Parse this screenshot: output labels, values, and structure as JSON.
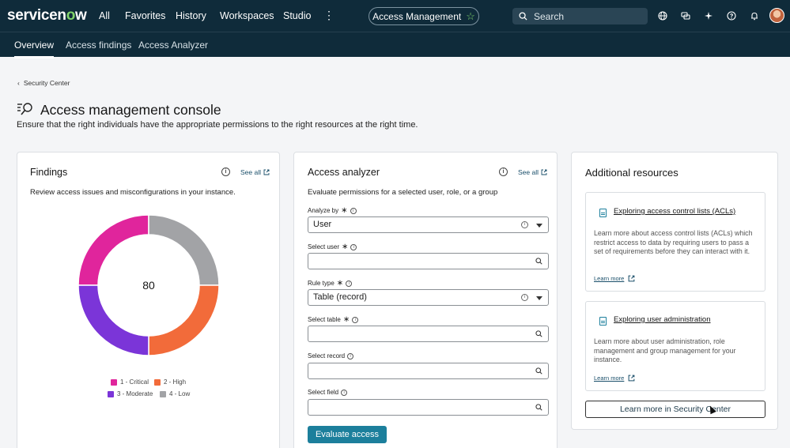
{
  "brand": {
    "logo_main": "servicen",
    "logo_accent": "o",
    "logo_tail": "w"
  },
  "topnav": {
    "items": [
      "All",
      "Favorites",
      "History",
      "Workspaces",
      "Studio"
    ],
    "app_pill": "Access Management",
    "search_placeholder": "Search",
    "icons": [
      "globe-icon",
      "chat-icon",
      "sparkle-icon",
      "help-icon",
      "bell-icon",
      "avatar"
    ]
  },
  "subnav": {
    "tabs": [
      "Overview",
      "Access findings",
      "Access Analyzer"
    ],
    "active": "Overview"
  },
  "breadcrumb": {
    "label": "Security Center"
  },
  "page": {
    "title": "Access management console",
    "subtitle": "Ensure that the right individuals have the appropriate permissions to the right resources at the right time."
  },
  "findings": {
    "title": "Findings",
    "see_all": "See all",
    "description": "Review access issues and misconfigurations in your instance.",
    "total": "80",
    "legend": [
      {
        "label": "1 - Critical",
        "color": "#e0259c"
      },
      {
        "label": "2 - High",
        "color": "#f26b3a"
      },
      {
        "label": "3 - Moderate",
        "color": "#7b35d8"
      },
      {
        "label": "4 - Low",
        "color": "#a2a3a6"
      }
    ]
  },
  "chart_data": {
    "type": "pie",
    "donut": true,
    "center_label": "80",
    "series": [
      {
        "name": "1 - Critical",
        "value": 20,
        "color": "#e0259c"
      },
      {
        "name": "4 - Low",
        "value": 20,
        "color": "#a2a3a6"
      },
      {
        "name": "2 - High",
        "value": 20,
        "color": "#f26b3a"
      },
      {
        "name": "3 - Moderate",
        "value": 20,
        "color": "#7b35d8"
      }
    ],
    "legend_position": "bottom"
  },
  "analyzer": {
    "title": "Access analyzer",
    "see_all": "See all",
    "description": "Evaluate permissions for a selected user, role, or a group",
    "fields": {
      "analyze_by": {
        "label": "Analyze by",
        "value": "User"
      },
      "select_user": {
        "label": "Select user",
        "value": ""
      },
      "rule_type": {
        "label": "Rule type",
        "value": "Table (record)"
      },
      "select_table": {
        "label": "Select table",
        "value": ""
      },
      "select_record": {
        "label": "Select record",
        "value": ""
      },
      "select_field": {
        "label": "Select field",
        "value": ""
      }
    },
    "submit": "Evaluate access"
  },
  "resources": {
    "title": "Additional resources",
    "items": [
      {
        "link": "Exploring access control lists (ACLs)",
        "text": "Learn more about access control lists (ACLs) which restrict access to data by requiring users to pass a set of requirements before they can interact with it.",
        "learn_more": "Learn more"
      },
      {
        "link": "Exploring user administration",
        "text": "Learn more about user administration, role management and group management for your instance.",
        "learn_more": "Learn more"
      }
    ],
    "button": "Learn more in Security Center"
  },
  "colors": {
    "header_bg": "#0f2b3a",
    "accent": "#1c7f9c",
    "brand_green": "#7fd36a"
  }
}
